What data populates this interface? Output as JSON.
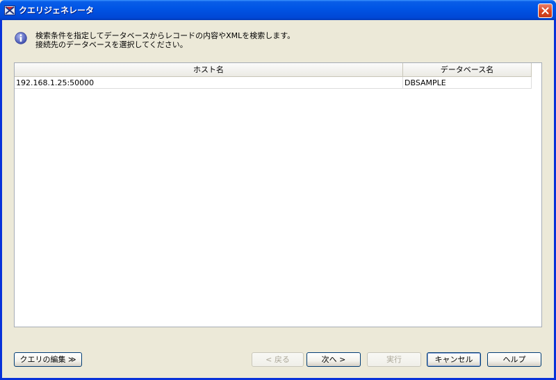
{
  "window": {
    "title": "クエリジェネレータ",
    "close_symbol": "✕"
  },
  "message": {
    "line1": "検索条件を指定してデータベースからレコードの内容やXMLを検索します。",
    "line2": "接続先のデータベースを選択してください。"
  },
  "table": {
    "columns": [
      "ホスト名",
      "データベース名"
    ],
    "rows": [
      {
        "host": "192.168.1.25:50000",
        "database": "DBSAMPLE"
      }
    ]
  },
  "buttons": {
    "edit_query": "クエリの編集 ≫",
    "back": "< 戻る",
    "next": "次へ >",
    "execute": "実行",
    "cancel": "キャンセル",
    "help": "ヘルプ"
  },
  "colors": {
    "titlebar": "#0055e5",
    "close_button": "#d9431d",
    "info_icon": "#5c6cc4",
    "dialog_bg": "#ece9d8"
  },
  "icons": {
    "app": "query-generator-icon",
    "info": "info-icon",
    "close": "close-icon"
  }
}
